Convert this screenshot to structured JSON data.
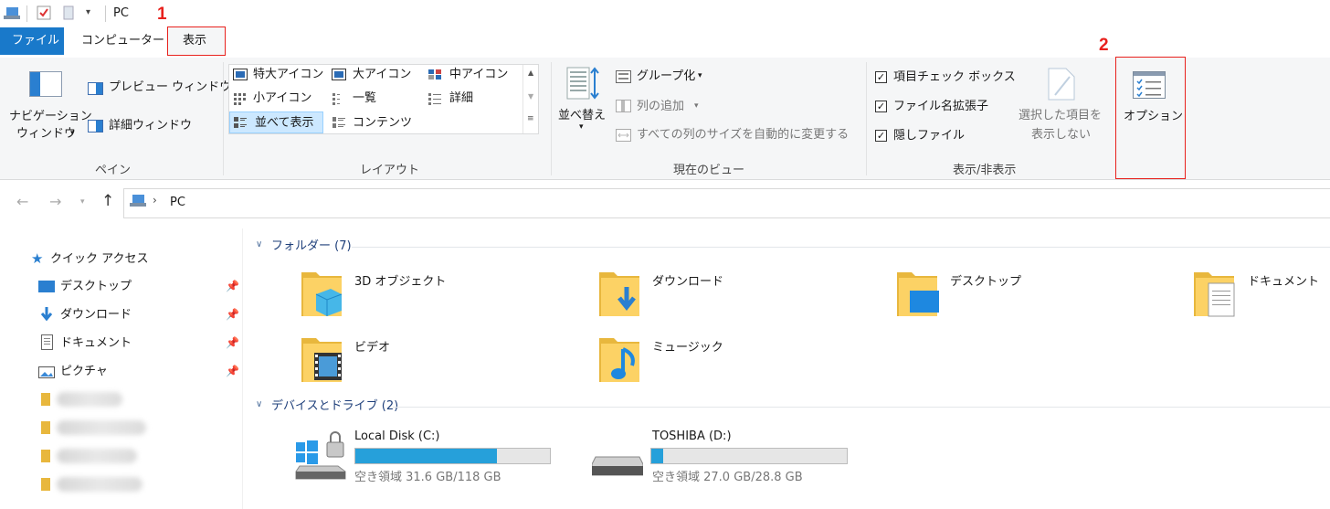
{
  "titlebar": {
    "title": "PC"
  },
  "tabs": {
    "file": "ファイル",
    "computer": "コンピューター",
    "view": "表示"
  },
  "annotations": {
    "step1": "1",
    "step2": "2"
  },
  "ribbon": {
    "pane": {
      "nav_pane_line1": "ナビゲーション",
      "nav_pane_line2": "ウィンドウ",
      "preview": "プレビュー ウィンドウ",
      "details": "詳細ウィンドウ",
      "group": "ペイン"
    },
    "layout": {
      "xlarge": "特大アイコン",
      "large": "大アイコン",
      "medium": "中アイコン",
      "small": "小アイコン",
      "list": "一覧",
      "details": "詳細",
      "tiles": "並べて表示",
      "content": "コンテンツ",
      "group": "レイアウト"
    },
    "current_view": {
      "sort": "並べ替え",
      "group_by": "グループ化",
      "add_columns": "列の追加",
      "fit_columns": "すべての列のサイズを自動的に変更する",
      "group": "現在のビュー"
    },
    "show_hide": {
      "item_checkboxes": "項目チェック ボックス",
      "extensions": "ファイル名拡張子",
      "hidden": "隠しファイル",
      "hide_selected_line1": "選択した項目を",
      "hide_selected_line2": "表示しない",
      "options": "オプション",
      "group": "表示/非表示"
    }
  },
  "address": {
    "path": "PC"
  },
  "sidebar": {
    "quick_access": "クイック アクセス",
    "items": [
      "デスクトップ",
      "ダウンロード",
      "ドキュメント",
      "ピクチャ"
    ]
  },
  "main": {
    "folders_header": "フォルダー (7)",
    "folders": [
      "3D オブジェクト",
      "ダウンロード",
      "デスクトップ",
      "ドキュメント",
      "ビデオ",
      "ミュージック"
    ],
    "drives_header": "デバイスとドライブ (2)",
    "drives": [
      {
        "name": "Local Disk (C:)",
        "free": "空き領域 31.6 GB/118 GB",
        "used_fraction": 0.73
      },
      {
        "name": "TOSHIBA (D:)",
        "free": "空き領域 27.0 GB/28.8 GB",
        "used_fraction": 0.06
      }
    ]
  }
}
